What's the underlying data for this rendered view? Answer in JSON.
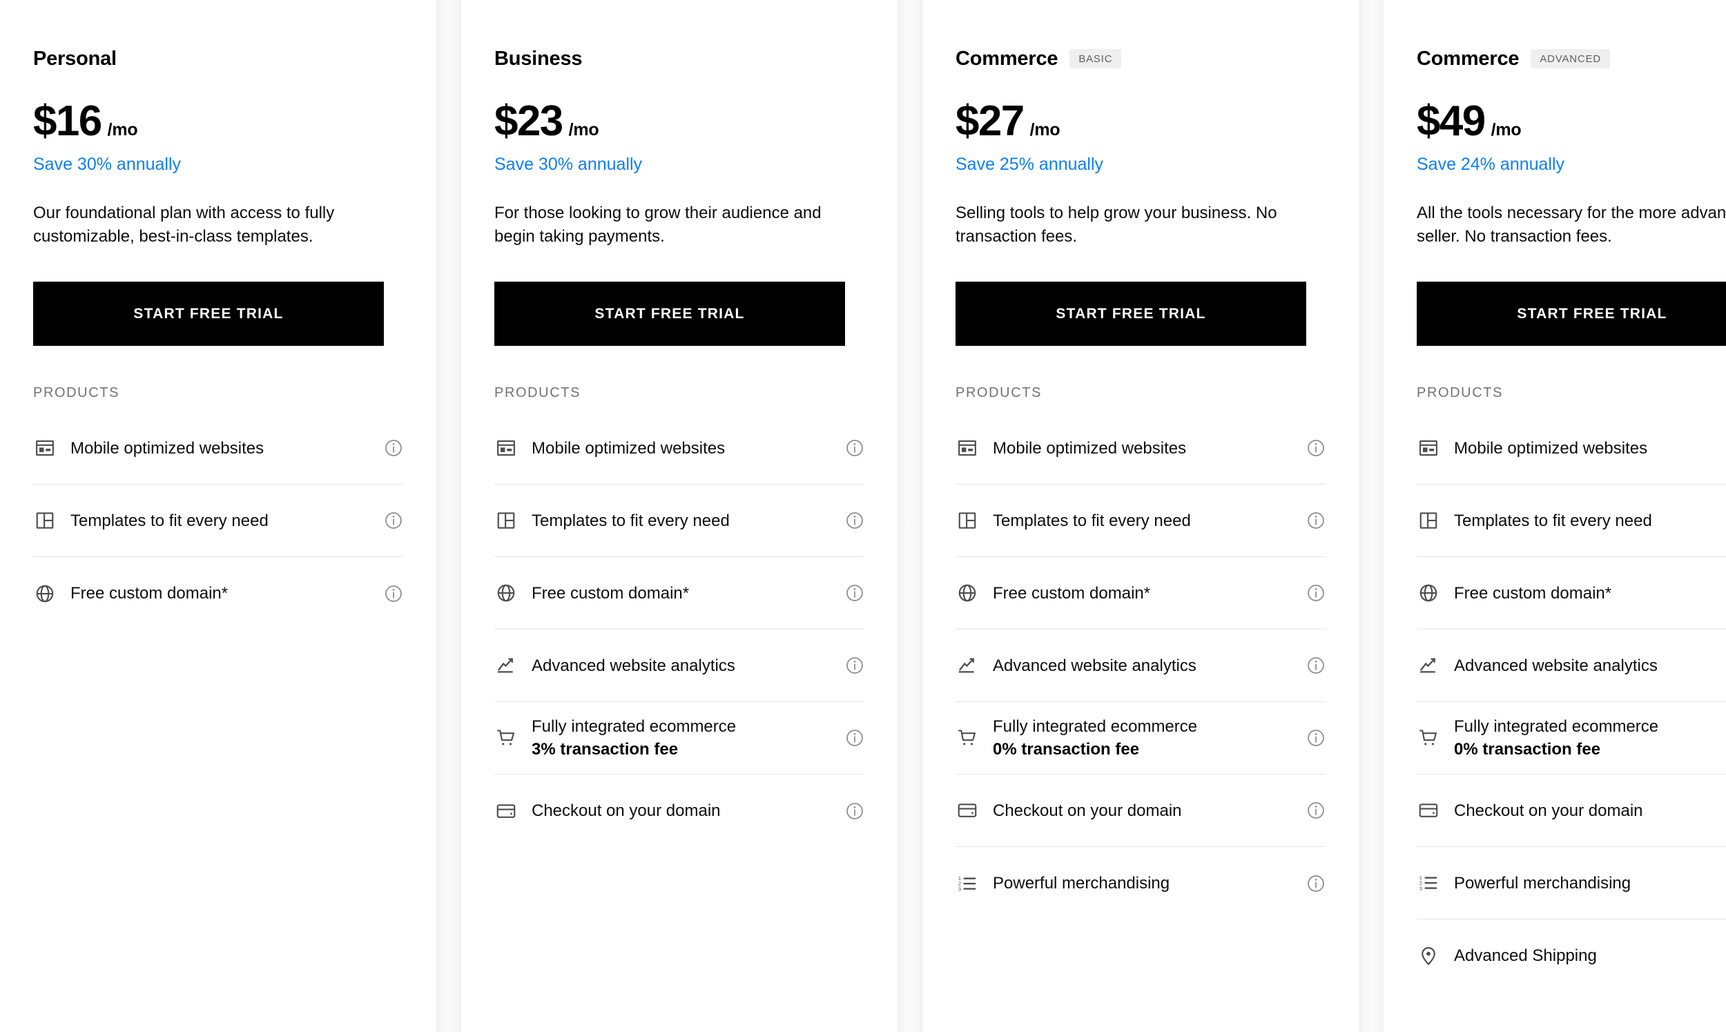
{
  "common": {
    "products_label": "PRODUCTS",
    "cta_label": "START FREE TRIAL",
    "info_icon_name": "info-icon",
    "accent_blue": "#0d7ff5",
    "badge_bg": "#efefef",
    "cta_bg": "#000000"
  },
  "plans": [
    {
      "name": "Personal",
      "badge": "",
      "price": "$16",
      "period": "/mo",
      "save": "Save 30% annually",
      "description": "Our foundational plan with access to fully customizable, best-in-class templates.",
      "cta": "START FREE TRIAL",
      "products_label": "PRODUCTS",
      "features": [
        {
          "icon": "browser-window-icon",
          "label": "Mobile optimized websites",
          "sub": ""
        },
        {
          "icon": "layout-templates-icon",
          "label": "Templates to fit every need",
          "sub": ""
        },
        {
          "icon": "globe-icon",
          "label": "Free custom domain*",
          "sub": ""
        }
      ]
    },
    {
      "name": "Business",
      "badge": "",
      "price": "$23",
      "period": "/mo",
      "save": "Save 30% annually",
      "description": "For those looking to grow their audience and begin taking payments.",
      "cta": "START FREE TRIAL",
      "products_label": "PRODUCTS",
      "features": [
        {
          "icon": "browser-window-icon",
          "label": "Mobile optimized websites",
          "sub": ""
        },
        {
          "icon": "layout-templates-icon",
          "label": "Templates to fit every need",
          "sub": ""
        },
        {
          "icon": "globe-icon",
          "label": "Free custom domain*",
          "sub": ""
        },
        {
          "icon": "analytics-chart-icon",
          "label": "Advanced website analytics",
          "sub": ""
        },
        {
          "icon": "shopping-cart-icon",
          "label": "Fully integrated ecommerce",
          "sub": "3% transaction fee"
        },
        {
          "icon": "credit-card-icon",
          "label": "Checkout on your domain",
          "sub": ""
        }
      ]
    },
    {
      "name": "Commerce",
      "badge": "BASIC",
      "price": "$27",
      "period": "/mo",
      "save": "Save 25% annually",
      "description": "Selling tools to help grow your business. No transaction fees.",
      "cta": "START FREE TRIAL",
      "products_label": "PRODUCTS",
      "features": [
        {
          "icon": "browser-window-icon",
          "label": "Mobile optimized websites",
          "sub": ""
        },
        {
          "icon": "layout-templates-icon",
          "label": "Templates to fit every need",
          "sub": ""
        },
        {
          "icon": "globe-icon",
          "label": "Free custom domain*",
          "sub": ""
        },
        {
          "icon": "analytics-chart-icon",
          "label": "Advanced website analytics",
          "sub": ""
        },
        {
          "icon": "shopping-cart-icon",
          "label": "Fully integrated ecommerce",
          "sub": "0% transaction fee"
        },
        {
          "icon": "credit-card-icon",
          "label": "Checkout on your domain",
          "sub": ""
        },
        {
          "icon": "ordered-list-icon",
          "label": "Powerful merchandising",
          "sub": ""
        }
      ]
    },
    {
      "name": "Commerce",
      "badge": "ADVANCED",
      "price": "$49",
      "period": "/mo",
      "save": "Save 24% annually",
      "description": "All the tools necessary for the more advanced seller. No transaction fees.",
      "cta": "START FREE TRIAL",
      "products_label": "PRODUCTS",
      "features": [
        {
          "icon": "browser-window-icon",
          "label": "Mobile optimized websites",
          "sub": ""
        },
        {
          "icon": "layout-templates-icon",
          "label": "Templates to fit every need",
          "sub": ""
        },
        {
          "icon": "globe-icon",
          "label": "Free custom domain*",
          "sub": ""
        },
        {
          "icon": "analytics-chart-icon",
          "label": "Advanced website analytics",
          "sub": ""
        },
        {
          "icon": "shopping-cart-icon",
          "label": "Fully integrated ecommerce",
          "sub": "0% transaction fee"
        },
        {
          "icon": "credit-card-icon",
          "label": "Checkout on your domain",
          "sub": ""
        },
        {
          "icon": "ordered-list-icon",
          "label": "Powerful merchandising",
          "sub": ""
        },
        {
          "icon": "map-pin-icon",
          "label": "Advanced Shipping",
          "sub": ""
        }
      ]
    }
  ]
}
